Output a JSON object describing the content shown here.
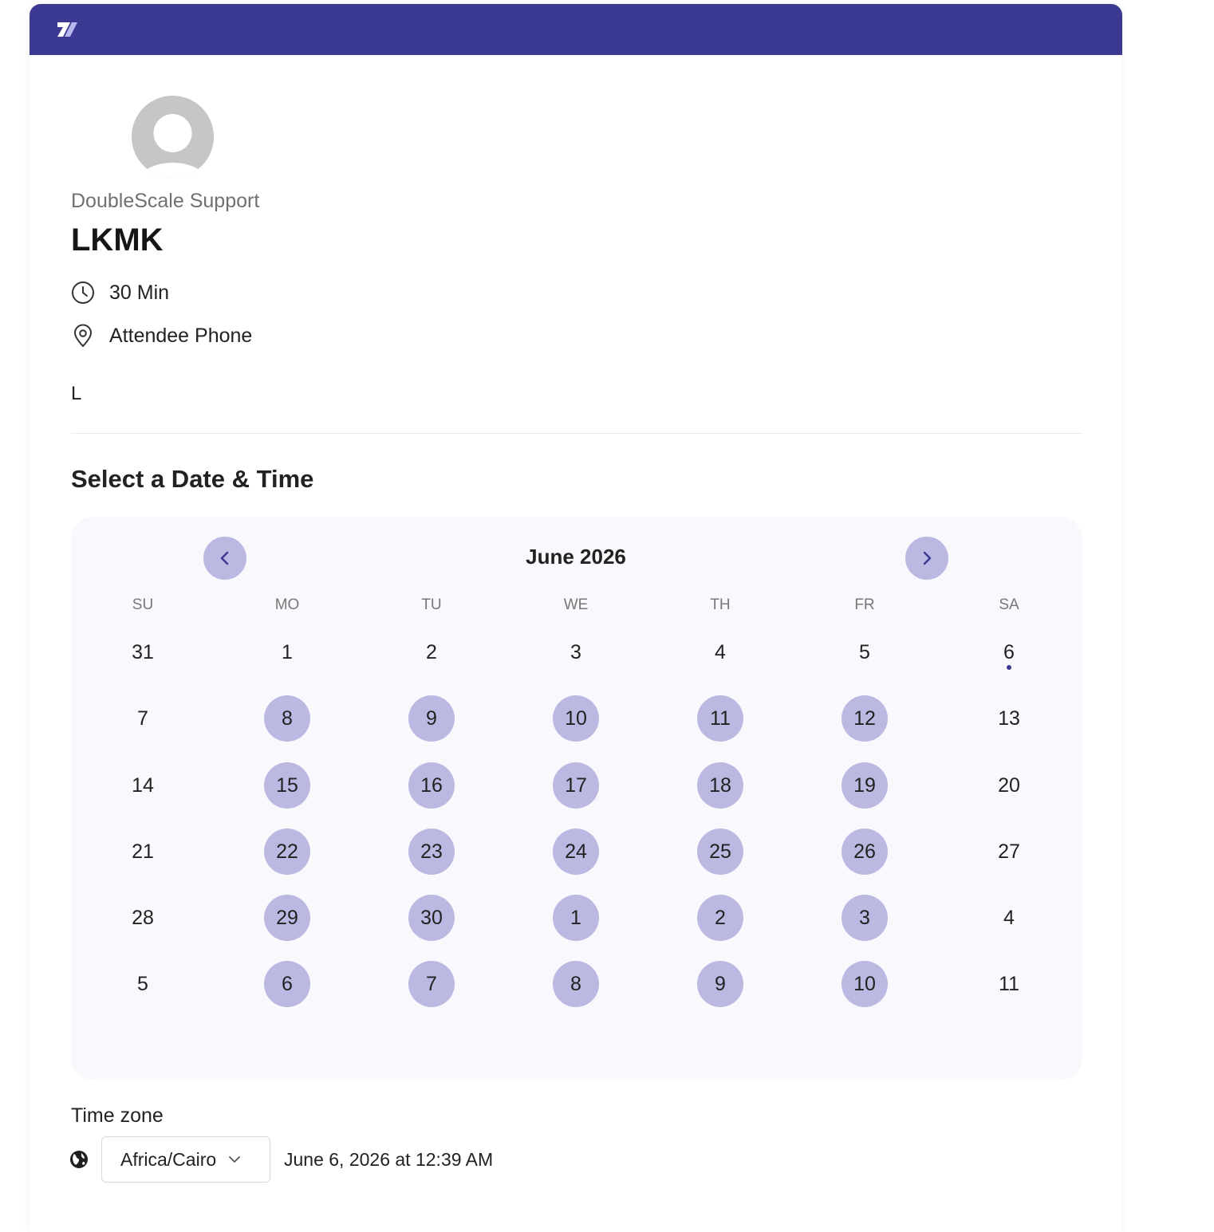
{
  "brand": {
    "logo_icon": "double-slash-logo-icon",
    "color": "#3b3992"
  },
  "profile": {
    "avatar_icon": "default-avatar-icon",
    "org_name": "DoubleScale Support",
    "event_title": "LKMK",
    "duration": "30 Min",
    "duration_icon": "clock-icon",
    "location": "Attendee Phone",
    "location_icon": "map-pin-icon",
    "description": "L"
  },
  "scheduler": {
    "section_title": "Select a Date & Time",
    "month_label": "June 2026",
    "prev_icon": "chevron-left-icon",
    "next_icon": "chevron-right-icon",
    "weekdays": [
      "SU",
      "MO",
      "TU",
      "WE",
      "TH",
      "FR",
      "SA"
    ],
    "weeks": [
      [
        {
          "d": "31",
          "a": false
        },
        {
          "d": "1",
          "a": false
        },
        {
          "d": "2",
          "a": false
        },
        {
          "d": "3",
          "a": false
        },
        {
          "d": "4",
          "a": false
        },
        {
          "d": "5",
          "a": false
        },
        {
          "d": "6",
          "a": false,
          "today": true
        }
      ],
      [
        {
          "d": "7",
          "a": false
        },
        {
          "d": "8",
          "a": true
        },
        {
          "d": "9",
          "a": true
        },
        {
          "d": "10",
          "a": true
        },
        {
          "d": "11",
          "a": true
        },
        {
          "d": "12",
          "a": true
        },
        {
          "d": "13",
          "a": false
        }
      ],
      [
        {
          "d": "14",
          "a": false
        },
        {
          "d": "15",
          "a": true
        },
        {
          "d": "16",
          "a": true
        },
        {
          "d": "17",
          "a": true
        },
        {
          "d": "18",
          "a": true
        },
        {
          "d": "19",
          "a": true
        },
        {
          "d": "20",
          "a": false
        }
      ],
      [
        {
          "d": "21",
          "a": false
        },
        {
          "d": "22",
          "a": true
        },
        {
          "d": "23",
          "a": true
        },
        {
          "d": "24",
          "a": true
        },
        {
          "d": "25",
          "a": true
        },
        {
          "d": "26",
          "a": true
        },
        {
          "d": "27",
          "a": false
        }
      ],
      [
        {
          "d": "28",
          "a": false
        },
        {
          "d": "29",
          "a": true
        },
        {
          "d": "30",
          "a": true
        },
        {
          "d": "1",
          "a": true
        },
        {
          "d": "2",
          "a": true
        },
        {
          "d": "3",
          "a": true
        },
        {
          "d": "4",
          "a": false
        }
      ],
      [
        {
          "d": "5",
          "a": false
        },
        {
          "d": "6",
          "a": true
        },
        {
          "d": "7",
          "a": true
        },
        {
          "d": "8",
          "a": true
        },
        {
          "d": "9",
          "a": true
        },
        {
          "d": "10",
          "a": true
        },
        {
          "d": "11",
          "a": false
        }
      ]
    ],
    "available_color": "#bbb8e2"
  },
  "timezone": {
    "label": "Time zone",
    "globe_icon": "globe-icon",
    "selected": "Africa/Cairo",
    "dropdown_icon": "chevron-down-icon",
    "current_time": "June 6, 2026 at 12:39 AM"
  }
}
